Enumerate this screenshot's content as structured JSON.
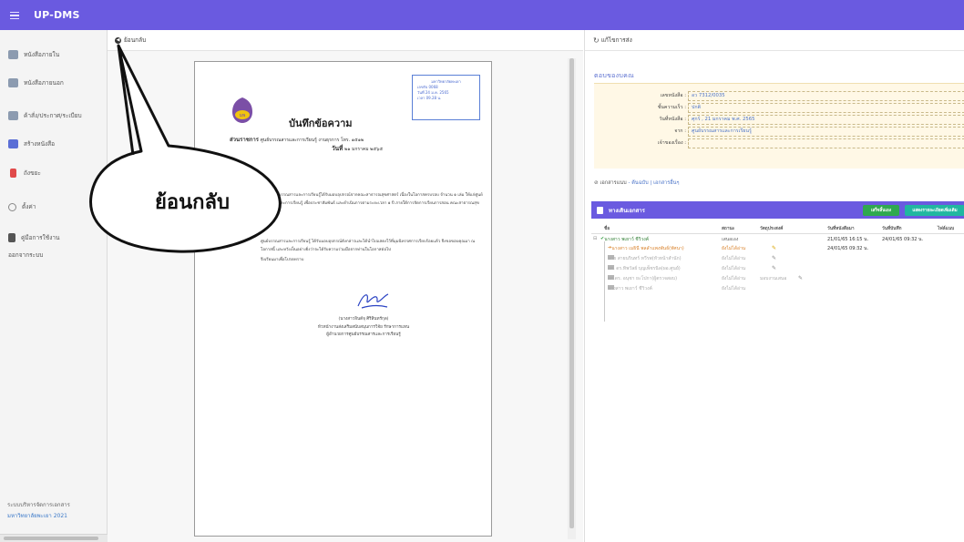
{
  "topbar": {
    "title": "UP-DMS"
  },
  "sidebar": {
    "items": [
      {
        "label": "หนังสือภายใน",
        "icon": "inbox-icon",
        "color": "#8c9bb0"
      },
      {
        "label": "หนังสือภายนอก",
        "icon": "inbox-external-icon",
        "color": "#8c9bb0"
      },
      {
        "label": "ค้าสั่ง/ประกาศ/ระเบียบ",
        "icon": "announcement-icon",
        "color": "#8c9bb0"
      },
      {
        "label": "สร้างหนังสือ",
        "icon": "create-document-icon",
        "color": "#5b6fd6"
      },
      {
        "label": "ถังขยะ",
        "icon": "trash-icon",
        "color": "#e04a4a"
      }
    ],
    "settings_label": "ตั้งค่า",
    "manual_label": "คู่มือการใช้งาน",
    "logout_label": "ออกจากระบบ",
    "footer_line1": "ระบบบริหารจัดการเอกสาร",
    "footer_line2": "มหาวิทยาลัยพะเยา 2021"
  },
  "document_pane": {
    "back_label": "ย้อนกลับ",
    "paper": {
      "stamp_lines": [
        "มหาวิทยาลัยพะเยา",
        "เลขรับ 0068",
        "วันที่ 24 ม.ค. 2565",
        "เวลา 09.28 น."
      ],
      "seal_text": "มพ",
      "title": "บันทึกข้อความ",
      "dept_label": "ส่วนราชการ",
      "dept_value": "ศูนย์บรรณสารและการเรียนรู้ งานธุรการ โทร. ๑๕๑๒",
      "date_label": "วันที่",
      "date_value": "๒๑ มกราคม ๒๕๖๕",
      "paragraph1": "ตามที่ศูนย์บรรณสารและการเรียนรู้ได้รับมอบอุปกรณ์จากคณะสาธารณสุขศาสตร์ เนื่องในโอกาสครบรอบ จำนวน ๑ เล่ม ให้แก่ศูนย์บรรณสารและการเรียนรู้ เพื่อประชาสัมพันธ์ และดำเนินการตามระยะเวลา ๑ ปี ภายใต้การจัดการเรียนการสอน คณะสาธารณสุขศาสตร์ นั้น",
      "paragraph2": "ศูนย์บรรณสารและการเรียนรู้ ได้รับมอบอุปกรณ์ดังกล่าวและได้นำไปแสดงไว้ที่มุมนิทรรศการเรียบร้อยแล้ว จึงขอขอบคุณมา ณ โอกาสนี้ และหวังเป็นอย่างยิ่งว่าจะได้รับความร่วมมือจากท่านในโอกาสต่อไป",
      "paragraph3": "จึงเรียนมาเพื่อโปรดทราบ",
      "signature_lines": [
        "(นางสาวจินต์จุ ศิริสินทร์กุล)",
        "หัวหน้างานส่งเสริมสนับสนุนการวิจัย รักษาการแทน",
        "ผู้อำนวยการศูนย์บรรณสารและการเรียนรู้"
      ]
    },
    "callout_text": "ย้อนกลับ"
  },
  "right_pane": {
    "refresh_label": "แก้ไขการส่ง",
    "section_title": "ตอบของบคณ",
    "info": [
      {
        "label": "เลขหนังสือ :",
        "value": "อว 7312/0035"
      },
      {
        "label": "ชั้นความเร็ว :",
        "value": "ปกติ"
      },
      {
        "label": "วันที่หนังสือ :",
        "value": "ศุกร์ , 21 มกราคม พ.ศ. 2565"
      },
      {
        "label": "จาก :",
        "value": "ศูนย์บรรณสารและการเรียนรู้"
      },
      {
        "label": "เจ้าของเรื่อง :",
        "value": ""
      }
    ],
    "attachments_label": "เอกสารแนบ",
    "attachments_link1": "ต้นฉบับ",
    "attachments_link2": "เอกสารอื่นๆ",
    "card_title": "ทางเดินเอกสาร",
    "btn_done": "เสร็จสิ้นเอง",
    "btn_more": "แสดงรายละเอียดเพิ่มเติม",
    "columns": [
      "ชื่อ",
      "สถานะ",
      "วัตถุประสงค์",
      "วันที่หนังสือมา",
      "วันที่บันทึก",
      "ไฟล์แนบ"
    ],
    "rows": [
      {
        "name": "นางสาว พเยาว์ ชีวิวงค์",
        "status": "เสนอเอง",
        "purpose": "",
        "sent": "21/01/65 16:15 น.",
        "recv": "24/01/65 09:32 น.",
        "style": "main"
      },
      {
        "name": "นางสาว เมธินี พลลำแพงพันธ์(ทัศนา)",
        "status": "ยังไม่ได้อ่าน",
        "purpose": "",
        "sent": "24/01/65 09:32 น.",
        "recv": "",
        "style": "orange"
      },
      {
        "name": "นาย สายนรินทร์ ทวีรพ(หัวหน้าสำนัก)",
        "status": "ยังไม่ได้อ่าน",
        "purpose": "",
        "sent": "",
        "recv": "",
        "style": "grey"
      },
      {
        "name": "ผศ. ดร.ทิพวัลย์ บุญเพ็ชรนิล(ผอ.ศูนย์)",
        "status": "ยังไม่ได้อ่าน",
        "purpose": "",
        "sent": "",
        "recv": "",
        "style": "grey"
      },
      {
        "name": "ผศ.ดร. อนุชา ยะโปกา(ผู้ตรวจสอบ)",
        "status": "ยังไม่ได้อ่าน",
        "purpose": "มอบงานเสนอ",
        "sent": "",
        "recv": "",
        "style": "grey"
      },
      {
        "name": "นางสาว พเยาว์ ชีวิวงค์",
        "status": "ยังไม่ได้อ่าน",
        "purpose": "",
        "sent": "",
        "recv": "",
        "style": "grey"
      }
    ]
  },
  "colors": {
    "primary": "#6a5ae0",
    "accent_link": "#4a73c8",
    "ok": "#2fa84f",
    "more": "#20b7a0",
    "info_bg": "#fff8e6"
  }
}
